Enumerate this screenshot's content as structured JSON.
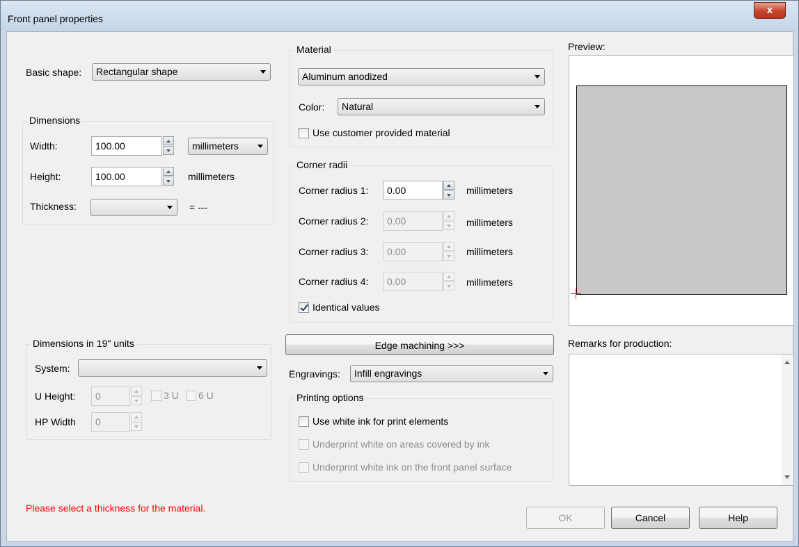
{
  "window": {
    "title": "Front panel properties",
    "close_label": "x"
  },
  "basic_shape": {
    "label": "Basic shape:",
    "value": "Rectangular shape"
  },
  "dimensions": {
    "legend": "Dimensions",
    "width_label": "Width:",
    "width_value": "100.00",
    "unit_select": "millimeters",
    "height_label": "Height:",
    "height_value": "100.00",
    "height_unit": "millimeters",
    "thickness_label": "Thickness:",
    "thickness_value": "",
    "thickness_result": "= ---"
  },
  "material": {
    "legend": "Material",
    "value": "Aluminum anodized",
    "color_label": "Color:",
    "color_value": "Natural",
    "customer_label": "Use customer provided material",
    "customer_checked": false
  },
  "corner_radii": {
    "legend": "Corner radii",
    "unit": "millimeters",
    "items": [
      {
        "label": "Corner radius 1:",
        "value": "0.00",
        "enabled": true
      },
      {
        "label": "Corner radius 2:",
        "value": "0.00",
        "enabled": false
      },
      {
        "label": "Corner radius 3:",
        "value": "0.00",
        "enabled": false
      },
      {
        "label": "Corner radius 4:",
        "value": "0.00",
        "enabled": false
      }
    ],
    "identical_label": "Identical values",
    "identical_checked": true
  },
  "preview": {
    "label": "Preview:"
  },
  "units19": {
    "legend": "Dimensions in 19\" units",
    "system_label": "System:",
    "system_value": "",
    "uheight_label": "U Height:",
    "uheight_value": "0",
    "cb_3u": "3 U",
    "cb_6u": "6 U",
    "hpwidth_label": "HP Width",
    "hpwidth_value": "0"
  },
  "edge_machining": {
    "label": "Edge machining >>>"
  },
  "engravings": {
    "label": "Engravings:",
    "value": "Infill engravings"
  },
  "printing": {
    "legend": "Printing options",
    "white_ink_label": "Use white ink  for print elements",
    "underprint_areas_label": "Underprint white on areas covered by ink",
    "underprint_surface_label": "Underprint white ink on the front panel surface"
  },
  "remarks": {
    "label": "Remarks for production:",
    "value": ""
  },
  "footer": {
    "error": "Please select a thickness for the material.",
    "ok_label": "OK",
    "cancel_label": "Cancel",
    "help_label": "Help"
  }
}
